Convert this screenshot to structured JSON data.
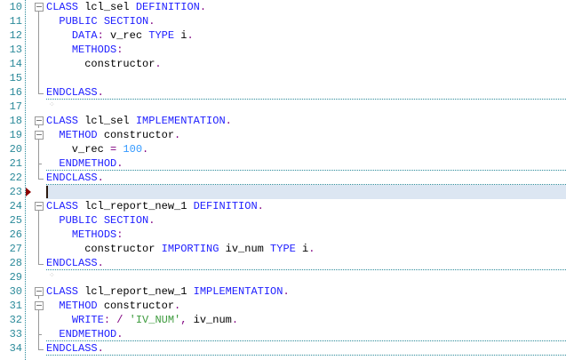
{
  "colors": {
    "keyword": "#2020ff",
    "punct": "#800080",
    "number": "#3399ff",
    "string": "#3c9a3c",
    "line_number": "#2b8a9a",
    "current_line": "#dce6f2"
  },
  "current_line": 23,
  "lines": [
    {
      "n": "10",
      "fold": "open",
      "sep": false,
      "tokens": [
        {
          "t": "CLASS",
          "c": "kw"
        },
        {
          "t": " lcl_sel ",
          "c": ""
        },
        {
          "t": "DEFINITION",
          "c": "kw"
        },
        {
          "t": ".",
          "c": "pu"
        }
      ]
    },
    {
      "n": "11",
      "fold": "v",
      "sep": false,
      "tokens": [
        {
          "t": "  ",
          "c": ""
        },
        {
          "t": "PUBLIC SECTION",
          "c": "kw"
        },
        {
          "t": ".",
          "c": "pu"
        }
      ]
    },
    {
      "n": "12",
      "fold": "v",
      "sep": false,
      "tokens": [
        {
          "t": "    ",
          "c": ""
        },
        {
          "t": "DATA",
          "c": "kw"
        },
        {
          "t": ":",
          "c": "pu"
        },
        {
          "t": " v_rec ",
          "c": ""
        },
        {
          "t": "TYPE",
          "c": "kw"
        },
        {
          "t": " i",
          "c": ""
        },
        {
          "t": ".",
          "c": "pu"
        }
      ]
    },
    {
      "n": "13",
      "fold": "v",
      "sep": false,
      "tokens": [
        {
          "t": "    ",
          "c": ""
        },
        {
          "t": "METHODS",
          "c": "kw"
        },
        {
          "t": ":",
          "c": "pu"
        }
      ]
    },
    {
      "n": "14",
      "fold": "v",
      "sep": false,
      "tokens": [
        {
          "t": "      constructor",
          "c": ""
        },
        {
          "t": ".",
          "c": "pu"
        }
      ]
    },
    {
      "n": "15",
      "fold": "v",
      "sep": false,
      "tokens": []
    },
    {
      "n": "16",
      "fold": "end",
      "sep": true,
      "tokens": [
        {
          "t": "ENDCLASS",
          "c": "kw"
        },
        {
          "t": ".",
          "c": "pu"
        }
      ]
    },
    {
      "n": "17",
      "fold": "",
      "sep": false,
      "mark": true,
      "tokens": []
    },
    {
      "n": "18",
      "fold": "open",
      "sep": false,
      "tokens": [
        {
          "t": "CLASS",
          "c": "kw"
        },
        {
          "t": " lcl_sel ",
          "c": ""
        },
        {
          "t": "IMPLEMENTATION",
          "c": "kw"
        },
        {
          "t": ".",
          "c": "pu"
        }
      ]
    },
    {
      "n": "19",
      "fold": "open",
      "sep": false,
      "tokens": [
        {
          "t": "  ",
          "c": ""
        },
        {
          "t": "METHOD",
          "c": "kw"
        },
        {
          "t": " constructor",
          "c": ""
        },
        {
          "t": ".",
          "c": "pu"
        }
      ]
    },
    {
      "n": "20",
      "fold": "v",
      "sep": false,
      "tokens": [
        {
          "t": "    v_rec ",
          "c": ""
        },
        {
          "t": "=",
          "c": "pu"
        },
        {
          "t": " ",
          "c": ""
        },
        {
          "t": "100",
          "c": "num"
        },
        {
          "t": ".",
          "c": "pu"
        }
      ]
    },
    {
      "n": "21",
      "fold": "tick",
      "sep": true,
      "tokens": [
        {
          "t": "  ",
          "c": ""
        },
        {
          "t": "ENDMETHOD",
          "c": "kw"
        },
        {
          "t": ".",
          "c": "pu"
        }
      ]
    },
    {
      "n": "22",
      "fold": "end",
      "sep": true,
      "tokens": [
        {
          "t": "ENDCLASS",
          "c": "kw"
        },
        {
          "t": ".",
          "c": "pu"
        }
      ]
    },
    {
      "n": "23",
      "fold": "",
      "sep": false,
      "tokens": []
    },
    {
      "n": "24",
      "fold": "open",
      "sep": false,
      "tokens": [
        {
          "t": "CLASS",
          "c": "kw"
        },
        {
          "t": " lcl_report_new_1 ",
          "c": ""
        },
        {
          "t": "DEFINITION",
          "c": "kw"
        },
        {
          "t": ".",
          "c": "pu"
        }
      ]
    },
    {
      "n": "25",
      "fold": "v",
      "sep": false,
      "tokens": [
        {
          "t": "  ",
          "c": ""
        },
        {
          "t": "PUBLIC SECTION",
          "c": "kw"
        },
        {
          "t": ".",
          "c": "pu"
        }
      ]
    },
    {
      "n": "26",
      "fold": "v",
      "sep": false,
      "tokens": [
        {
          "t": "    ",
          "c": ""
        },
        {
          "t": "METHODS",
          "c": "kw"
        },
        {
          "t": ":",
          "c": "pu"
        }
      ]
    },
    {
      "n": "27",
      "fold": "v",
      "sep": false,
      "tokens": [
        {
          "t": "      constructor ",
          "c": ""
        },
        {
          "t": "IMPORTING",
          "c": "kw"
        },
        {
          "t": " iv_num ",
          "c": ""
        },
        {
          "t": "TYPE",
          "c": "kw"
        },
        {
          "t": " i",
          "c": ""
        },
        {
          "t": ".",
          "c": "pu"
        }
      ]
    },
    {
      "n": "28",
      "fold": "end",
      "sep": true,
      "tokens": [
        {
          "t": "ENDCLASS",
          "c": "kw"
        },
        {
          "t": ".",
          "c": "pu"
        }
      ]
    },
    {
      "n": "29",
      "fold": "",
      "sep": false,
      "mark": true,
      "tokens": []
    },
    {
      "n": "30",
      "fold": "open",
      "sep": false,
      "tokens": [
        {
          "t": "CLASS",
          "c": "kw"
        },
        {
          "t": " lcl_report_new_1 ",
          "c": ""
        },
        {
          "t": "IMPLEMENTATION",
          "c": "kw"
        },
        {
          "t": ".",
          "c": "pu"
        }
      ]
    },
    {
      "n": "31",
      "fold": "open",
      "sep": false,
      "tokens": [
        {
          "t": "  ",
          "c": ""
        },
        {
          "t": "METHOD",
          "c": "kw"
        },
        {
          "t": " constructor",
          "c": ""
        },
        {
          "t": ".",
          "c": "pu"
        }
      ]
    },
    {
      "n": "32",
      "fold": "v",
      "sep": false,
      "tokens": [
        {
          "t": "    ",
          "c": ""
        },
        {
          "t": "WRITE",
          "c": "kw"
        },
        {
          "t": ":",
          "c": "pu"
        },
        {
          "t": " ",
          "c": ""
        },
        {
          "t": "/",
          "c": "pu"
        },
        {
          "t": " ",
          "c": ""
        },
        {
          "t": "'IV_NUM'",
          "c": "str"
        },
        {
          "t": ",",
          "c": "pu"
        },
        {
          "t": " iv_num",
          "c": ""
        },
        {
          "t": ".",
          "c": "pu"
        }
      ]
    },
    {
      "n": "33",
      "fold": "tick",
      "sep": true,
      "tokens": [
        {
          "t": "  ",
          "c": ""
        },
        {
          "t": "ENDMETHOD",
          "c": "kw"
        },
        {
          "t": ".",
          "c": "pu"
        }
      ]
    },
    {
      "n": "34",
      "fold": "end",
      "sep": true,
      "tokens": [
        {
          "t": "ENDCLASS",
          "c": "kw"
        },
        {
          "t": ".",
          "c": "pu"
        }
      ]
    }
  ]
}
